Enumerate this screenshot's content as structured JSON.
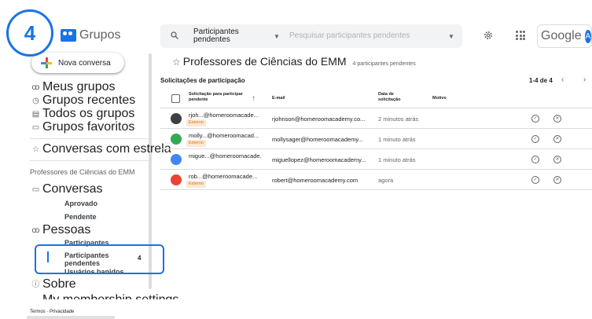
{
  "step": "4",
  "app": {
    "name": "Grupos"
  },
  "search": {
    "scope": "Participantes pendentes",
    "placeholder": "Pesquisar participantes pendentes"
  },
  "header": {
    "google": "Google",
    "avatar_letter": "A"
  },
  "compose": {
    "label": "Nova conversa"
  },
  "sidebar": {
    "my_groups": "Meus grupos",
    "recent": "Grupos recentes",
    "all": "Todos os grupos",
    "favorites": "Grupos favoritos",
    "starred": "Conversas com estrela",
    "group_name": "Professores de Ciências do EMM",
    "conversations": "Conversas",
    "approved": "Aprovado",
    "pending": "Pendente",
    "people": "Pessoas",
    "members": "Participantes",
    "pending_members": "Participantes pendentes",
    "pending_members_count": "4",
    "banned": "Usuários banidos",
    "about": "Sobre",
    "membership": "My membership settings",
    "footer": "Termos · Privacidade"
  },
  "main": {
    "title": "Professores de Ciências do EMM",
    "pending_label": "4 participantes pendentes",
    "requests_title": "Solicitações de participação",
    "pagination": "1-4 de 4"
  },
  "table": {
    "headers": {
      "requester": "Solicitação para participar pendente",
      "email": "E-mail",
      "date": "Data de solicitação",
      "reason": "Motivo"
    },
    "rows": [
      {
        "name": "rjoh...@homeroomacade...",
        "badge": "Externo",
        "email": "rjohnson@homeroomacademy.co...",
        "date": "2 minutos atrás",
        "avatar_color": "#3c4043"
      },
      {
        "name": "molly...@homeroomacad...",
        "badge": "Externo",
        "email": "mollysager@homeroomacademy...",
        "date": "1 minuto atrás",
        "avatar_color": "#34a853"
      },
      {
        "name": "migue...@homeroomacade...",
        "badge": "",
        "email": "miguellopez@homeroomacademy...",
        "date": "1 minuto atrás",
        "avatar_color": "#4285f4"
      },
      {
        "name": "rob...@homeroomacade...",
        "badge": "Externo",
        "email": "robert@homeroomacademy.com",
        "date": "agora",
        "avatar_color": "#ea4335"
      }
    ]
  }
}
